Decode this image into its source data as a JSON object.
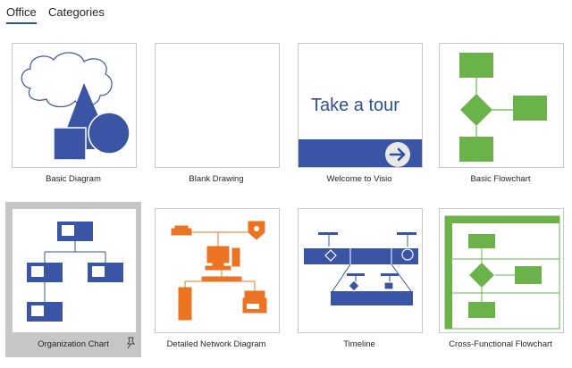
{
  "tabs": [
    {
      "label": "Office",
      "active": true
    },
    {
      "label": "Categories",
      "active": false
    }
  ],
  "templates": [
    {
      "label": "Basic Diagram"
    },
    {
      "label": "Blank Drawing"
    },
    {
      "label": "Welcome to Visio",
      "thumb_text": "Take a tour"
    },
    {
      "label": "Basic Flowchart"
    },
    {
      "label": "Organization Chart",
      "selected": true
    },
    {
      "label": "Detailed Network Diagram"
    },
    {
      "label": "Timeline"
    },
    {
      "label": "Cross-Functional Flowchart"
    }
  ],
  "icons": {
    "pin": "pin-icon",
    "arrow": "arrow-right-icon"
  },
  "colors": {
    "blue": "#3a55a4",
    "green": "#6cb24a",
    "orange": "#ea7423",
    "selection": "#c6c6c6",
    "tab_underline": "#2b579a"
  }
}
